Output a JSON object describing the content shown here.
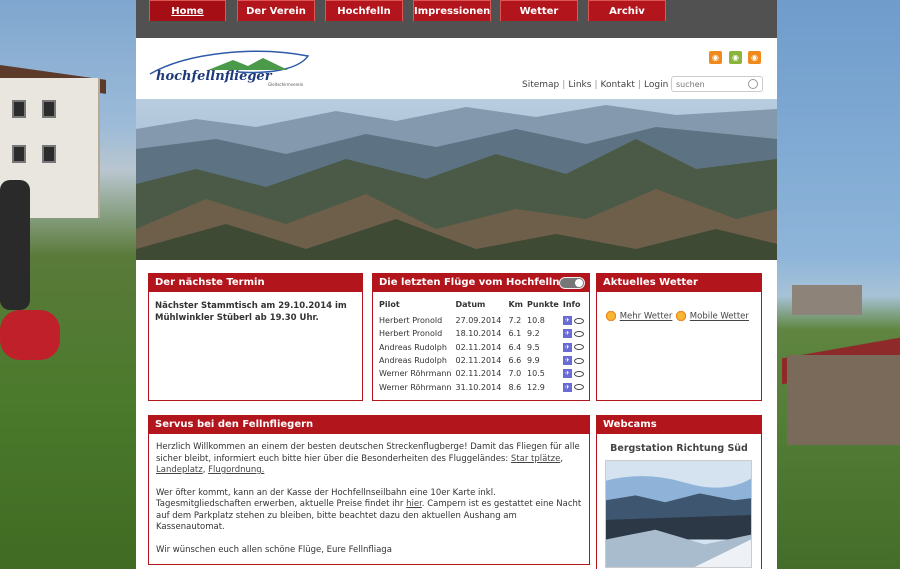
{
  "nav": {
    "items": [
      {
        "label": "Home",
        "active": true
      },
      {
        "label": "Der Verein",
        "active": false
      },
      {
        "label": "Hochfelln",
        "active": false
      },
      {
        "label": "Impressionen",
        "active": false
      },
      {
        "label": "Wetter",
        "active": false
      },
      {
        "label": "Archiv",
        "active": false
      }
    ]
  },
  "header": {
    "logo_text": "hochfellnflieger",
    "logo_sub": "Gleitschirmverein",
    "links": [
      "Sitemap",
      "Links",
      "Kontakt",
      "Login"
    ],
    "search_placeholder": "suchen",
    "feed_icons": [
      "rss-icon",
      "rss-icon",
      "rss-icon"
    ]
  },
  "termin": {
    "title": "Der nächste Termin",
    "text": "Nächster Stammtisch am 29.10.2014 im Mühlwinkler Stüberl ab 19.30 Uhr."
  },
  "fluege": {
    "title": "Die letzten Flüge vom Hochfelln",
    "columns": [
      "Pilot",
      "Datum",
      "Km",
      "Punkte",
      "Info"
    ],
    "rows": [
      [
        "Herbert Pronold",
        "27.09.2014",
        "7.2",
        "10.8"
      ],
      [
        "Herbert Pronold",
        "18.10.2014",
        "6.1",
        "9.2"
      ],
      [
        "Andreas Rudolph",
        "02.11.2014",
        "6.4",
        "9.5"
      ],
      [
        "Andreas Rudolph",
        "02.11.2014",
        "6.6",
        "9.9"
      ],
      [
        "Werner Röhrmann",
        "02.11.2014",
        "7.0",
        "10.5"
      ],
      [
        "Werner Röhrmann",
        "31.10.2014",
        "8.6",
        "12.9"
      ]
    ]
  },
  "wetter": {
    "title": "Aktuelles Wetter",
    "link1": "Mehr Wetter",
    "link2": "Mobile Wetter"
  },
  "servus": {
    "title": "Servus bei den Fellnfliegern",
    "p1_a": "Herzlich Willkommen an einem der besten deutschen Streckenflugberge! Damit das Fliegen für alle sicher bleibt, informiert euch bitte hier über die Besonderheiten des Fluggeländes: ",
    "p1_link1": "Star tplätze",
    "p1_sep1": ", ",
    "p1_link2": "Landeplatz",
    "p1_sep2": ", ",
    "p1_link3": "Flugordnung.",
    "p2_a": "Wer öfter kommt, kann an der Kasse der Hochfellnseilbahn eine 10er Karte inkl. Tagesmitgliedschaften erwerben, aktuelle Preise findet ihr ",
    "p2_link": "hier",
    "p2_b": ". Campern ist es gestattet eine Nacht auf dem Parkplatz stehen zu  bleiben, bitte beachtet dazu den aktuellen Aushang am Kassenautomat.",
    "p3": "Wir wünschen euch allen schöne Flüge, Eure Fellnfliaga"
  },
  "webcams": {
    "title": "Webcams",
    "caption": "Bergstation Richtung Süd"
  },
  "colors": {
    "accent": "#b3151c",
    "topbar": "#515151"
  }
}
